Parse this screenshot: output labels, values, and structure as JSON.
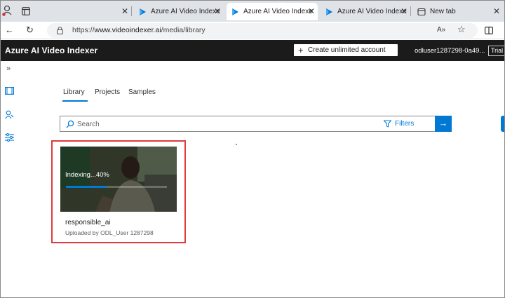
{
  "browser": {
    "tabs": [
      {
        "label": ""
      },
      {
        "label": "Azure AI Video Indexe"
      },
      {
        "label": "Azure AI Video Indexe"
      },
      {
        "label": "Azure AI Video Indexe"
      },
      {
        "label": "New tab"
      }
    ],
    "url_prefix": "https://",
    "url_host": "www.videoindexer.ai",
    "url_path": "/media/library"
  },
  "app": {
    "title": "Azure AI Video Indexer",
    "create_account": "Create unlimited account",
    "user": "odluser1287298-0a49...",
    "trial_badge": "Trial"
  },
  "pivot": {
    "tabs": [
      "Library",
      "Projects",
      "Samples"
    ],
    "active_index": 0
  },
  "search": {
    "placeholder": "Search",
    "filters_label": "Filters"
  },
  "card": {
    "status": "Indexing...40%",
    "progress": 0.4,
    "name": "responsible_ai",
    "uploaded_by": "Uploaded by ODL_User 1287298"
  },
  "colors": {
    "accent": "#0078d4",
    "header_bg": "#1b1b1b",
    "highlight": "#e03a3a"
  }
}
